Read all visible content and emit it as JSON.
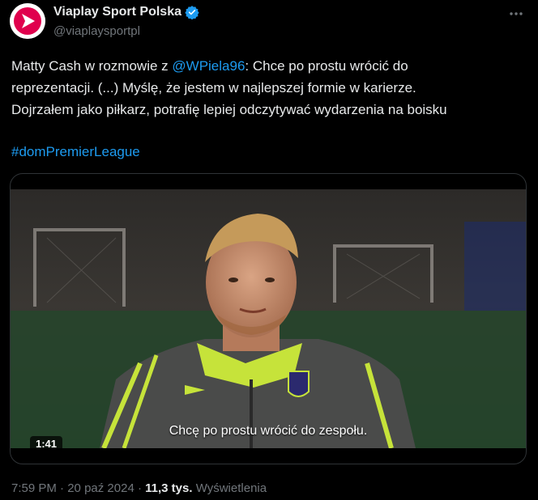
{
  "author": {
    "display_name": "Viaplay Sport Polska",
    "handle": "@viaplaysportpl",
    "verified_icon": "verified-badge-icon",
    "avatar_icon": "viaplay-logo-icon",
    "avatar_color": "#e0004d"
  },
  "tweet": {
    "line1_prefix": "Matty Cash w rozmowie z ",
    "mention": "@WPiela96",
    "line1_suffix": ": Chce po prostu wrócić do",
    "line2": "reprezentacji. (...) Myślę, że jestem w najlepszej formie w karierze.",
    "line3": "Dojrzałem jako piłkarz, potrafię lepiej odczytywać wydarzenia na boisku",
    "hashtag": "#domPremierLeague"
  },
  "media": {
    "subtitle": "Chcę po prostu wrócić do zespołu.",
    "duration": "1:41"
  },
  "footer": {
    "time": "7:59 PM",
    "sep1": " · ",
    "date": "20 paź 2024",
    "sep2": " · ",
    "views_count": "11,3 tys.",
    "views_label": " Wyświetlenia"
  },
  "icons": {
    "more": "more-horizontal-icon"
  },
  "colors": {
    "background": "#000000",
    "text": "#e7e9ea",
    "secondary_text": "#71767b",
    "link": "#1d9bf0",
    "verified": "#1d9bf0",
    "border": "#2f3336"
  }
}
